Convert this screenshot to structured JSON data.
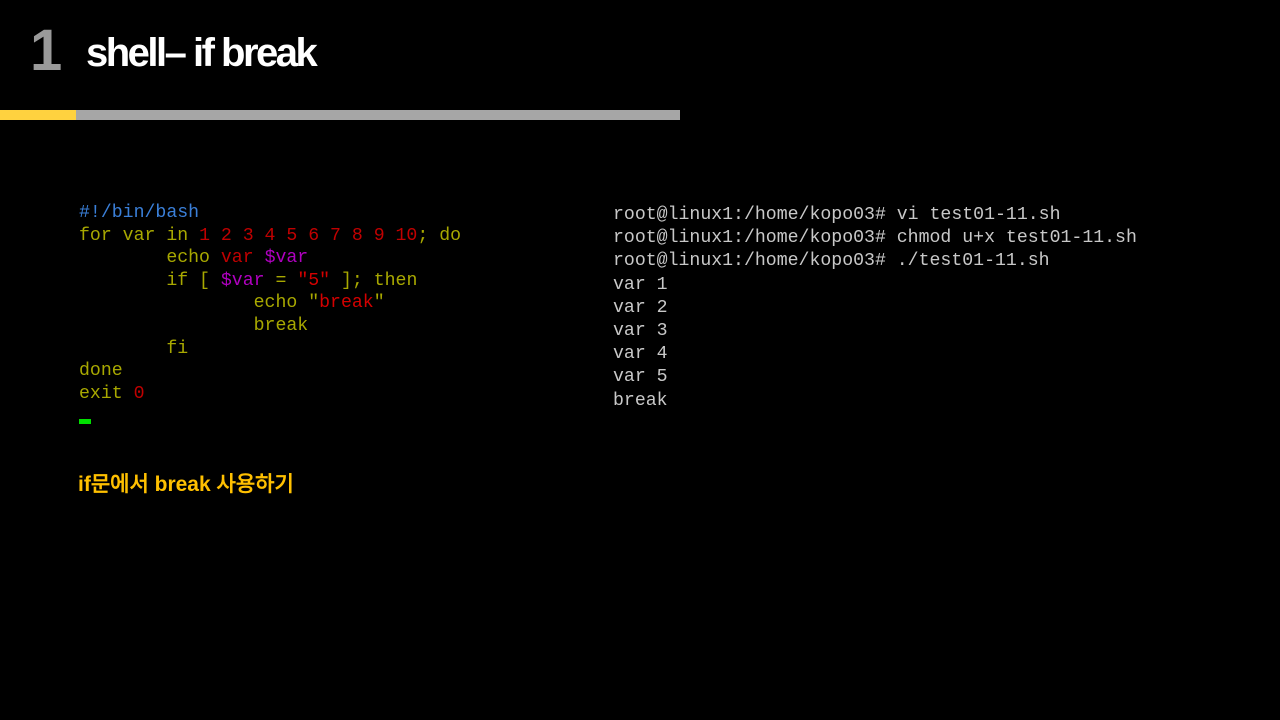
{
  "slide": {
    "number": "1",
    "title": "shell– if break",
    "caption": "if문에서 break 사용하기"
  },
  "colors": {
    "slide_number": "#9a9a9a",
    "title": "#ffffff",
    "bar_accent": "#ffd23f",
    "bar_rest": "#a6a6a6",
    "caption": "#ffc000",
    "code_keyword": "#a8a800",
    "code_comment": "#3a7fd8",
    "code_number": "#c00000",
    "code_variable": "#b000c0",
    "code_string": "#d40000",
    "terminal_text": "#c8c8c8",
    "cursor": "#00e000"
  },
  "script_lines": [
    [
      {
        "text": "#!/bin/bash",
        "color": "#3a7fd8"
      }
    ],
    [
      {
        "text": "for var in ",
        "color": "#a8a800"
      },
      {
        "text": "1 2 3 4 5 6 7 8 9 10",
        "color": "#c00000"
      },
      {
        "text": "; do",
        "color": "#a8a800"
      }
    ],
    [
      {
        "text": "        echo ",
        "color": "#a8a800"
      },
      {
        "text": "var ",
        "color": "#c00000"
      },
      {
        "text": "$var",
        "color": "#b000c0"
      }
    ],
    [
      {
        "text": "        if [ ",
        "color": "#a8a800"
      },
      {
        "text": "$var",
        "color": "#b000c0"
      },
      {
        "text": " = ",
        "color": "#a8a800"
      },
      {
        "text": "\"5\"",
        "color": "#d40000"
      },
      {
        "text": " ]; then",
        "color": "#a8a800"
      }
    ],
    [
      {
        "text": "                echo ",
        "color": "#a8a800"
      },
      {
        "text": "\"",
        "color": "#a8a800"
      },
      {
        "text": "break",
        "color": "#d40000"
      },
      {
        "text": "\"",
        "color": "#a8a800"
      }
    ],
    [
      {
        "text": "                break",
        "color": "#a8a800"
      }
    ],
    [
      {
        "text": "        fi",
        "color": "#a8a800"
      }
    ],
    [
      {
        "text": "done",
        "color": "#a8a800"
      }
    ],
    [
      {
        "text": "exit ",
        "color": "#a8a800"
      },
      {
        "text": "0",
        "color": "#c00000"
      }
    ]
  ],
  "terminal_lines": [
    "root@linux1:/home/kopo03# vi test01-11.sh",
    "root@linux1:/home/kopo03# chmod u+x test01-11.sh",
    "root@linux1:/home/kopo03# ./test01-11.sh",
    "var 1",
    "var 2",
    "var 3",
    "var 4",
    "var 5",
    "break"
  ]
}
